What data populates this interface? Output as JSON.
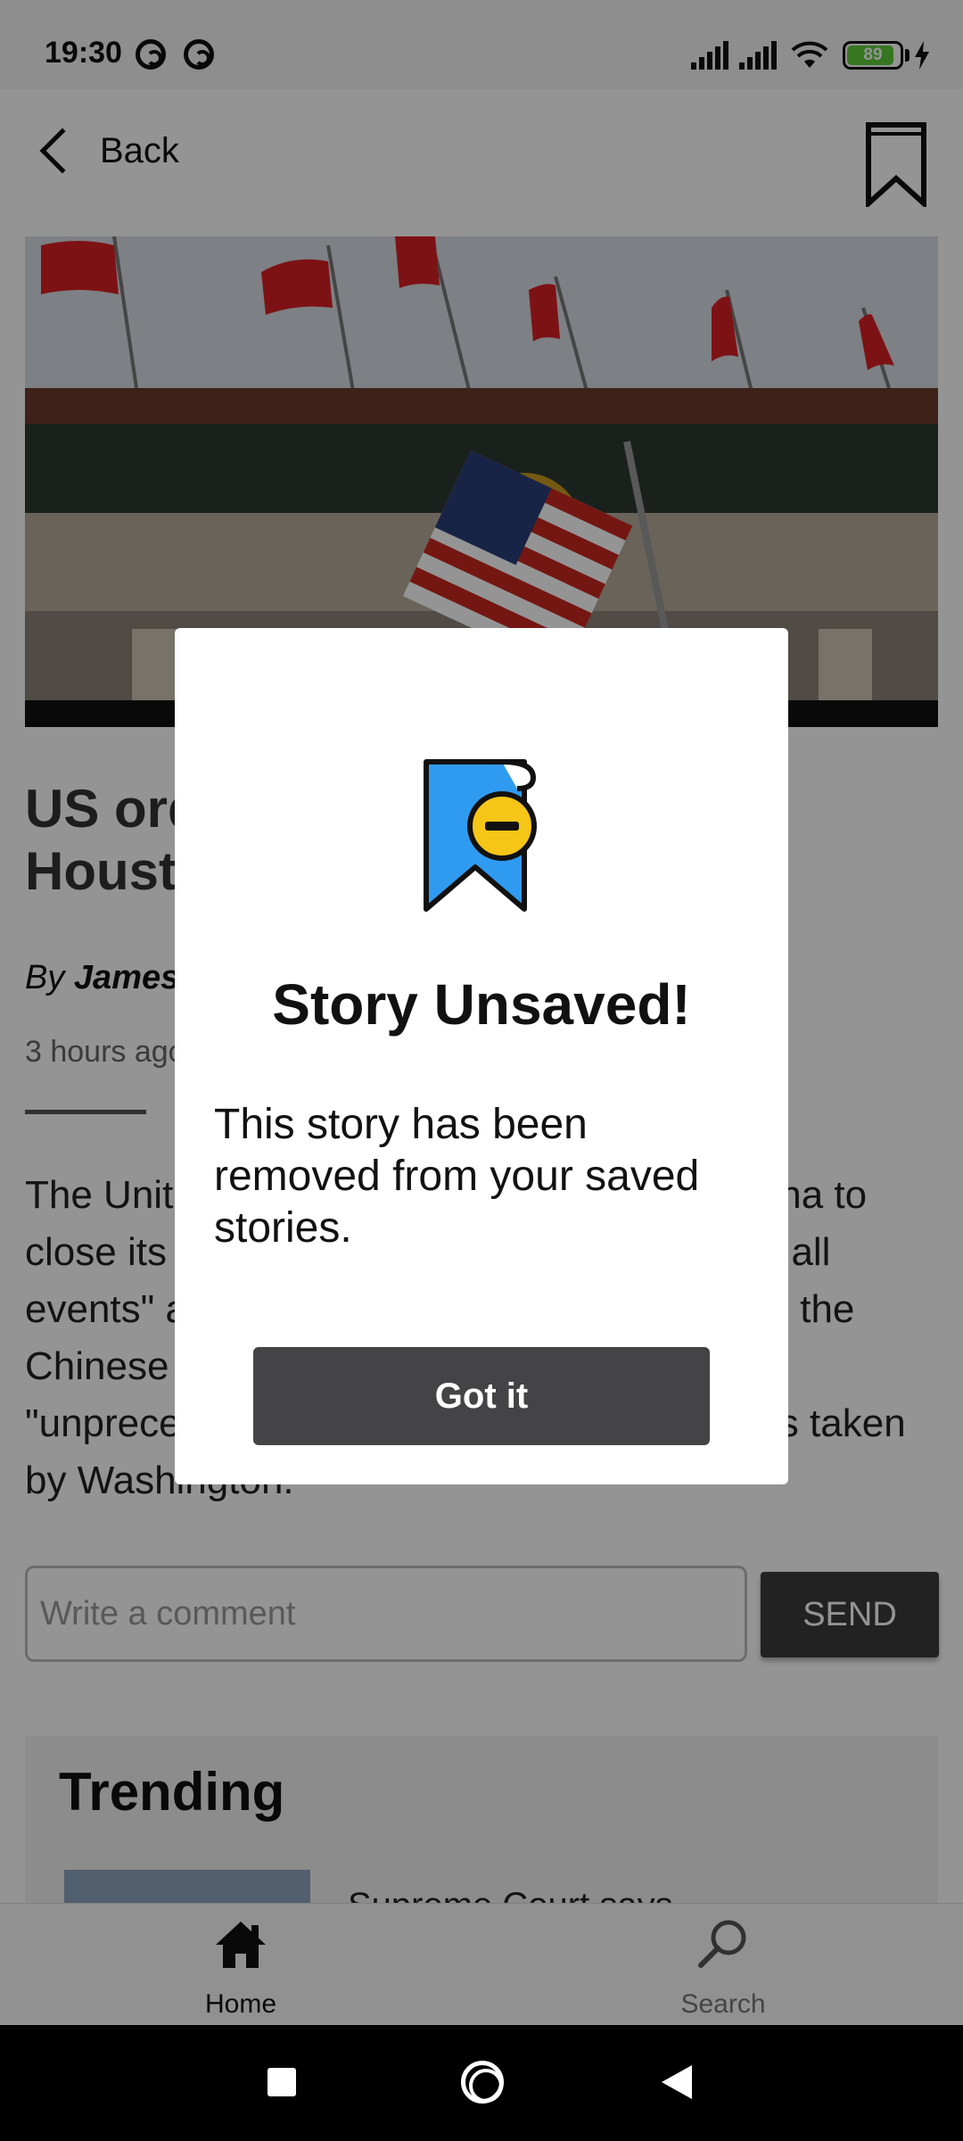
{
  "status_bar": {
    "time": "19:30",
    "battery_level": "89",
    "battery_fraction": 0.89,
    "icons": [
      "vpn-icon",
      "data-saver-icon",
      "signal-icon",
      "signal-icon",
      "wifi-icon",
      "battery-icon",
      "charging-icon"
    ]
  },
  "header": {
    "back_label": "Back",
    "bookmark_icon": "bookmark-outline-icon"
  },
  "article": {
    "title": "US ordered China to close its Houston consulate",
    "byline_prefix": "By",
    "author": "James Griffiths",
    "time_ago": "3 hours ago",
    "body": "The United States has abruptly ordered China to close its Houston consulate, \"shutting down all events\" and evicting diplomats, according to the Chinese ministry, in what it called an \"unprecedented escalation\" in recent actions taken by Washington."
  },
  "comment": {
    "placeholder": "Write a comment",
    "send_label": "SEND"
  },
  "trending": {
    "title": "Trending",
    "first_headline": "Supreme Court says"
  },
  "bottom_nav": {
    "items": [
      {
        "label": "Home",
        "icon": "home-icon",
        "active": true
      },
      {
        "label": "Search",
        "icon": "search-icon",
        "active": false
      }
    ]
  },
  "dialog": {
    "icon": "bookmark-remove-icon",
    "title": "Story Unsaved!",
    "message": "This story has been removed from your saved stories.",
    "button_label": "Got it"
  },
  "colors": {
    "dialog_button": "#444447",
    "bookmark_blue": "#2f9bf0",
    "minus_badge": "#f5c518",
    "battery_green": "#5ecc3a"
  }
}
